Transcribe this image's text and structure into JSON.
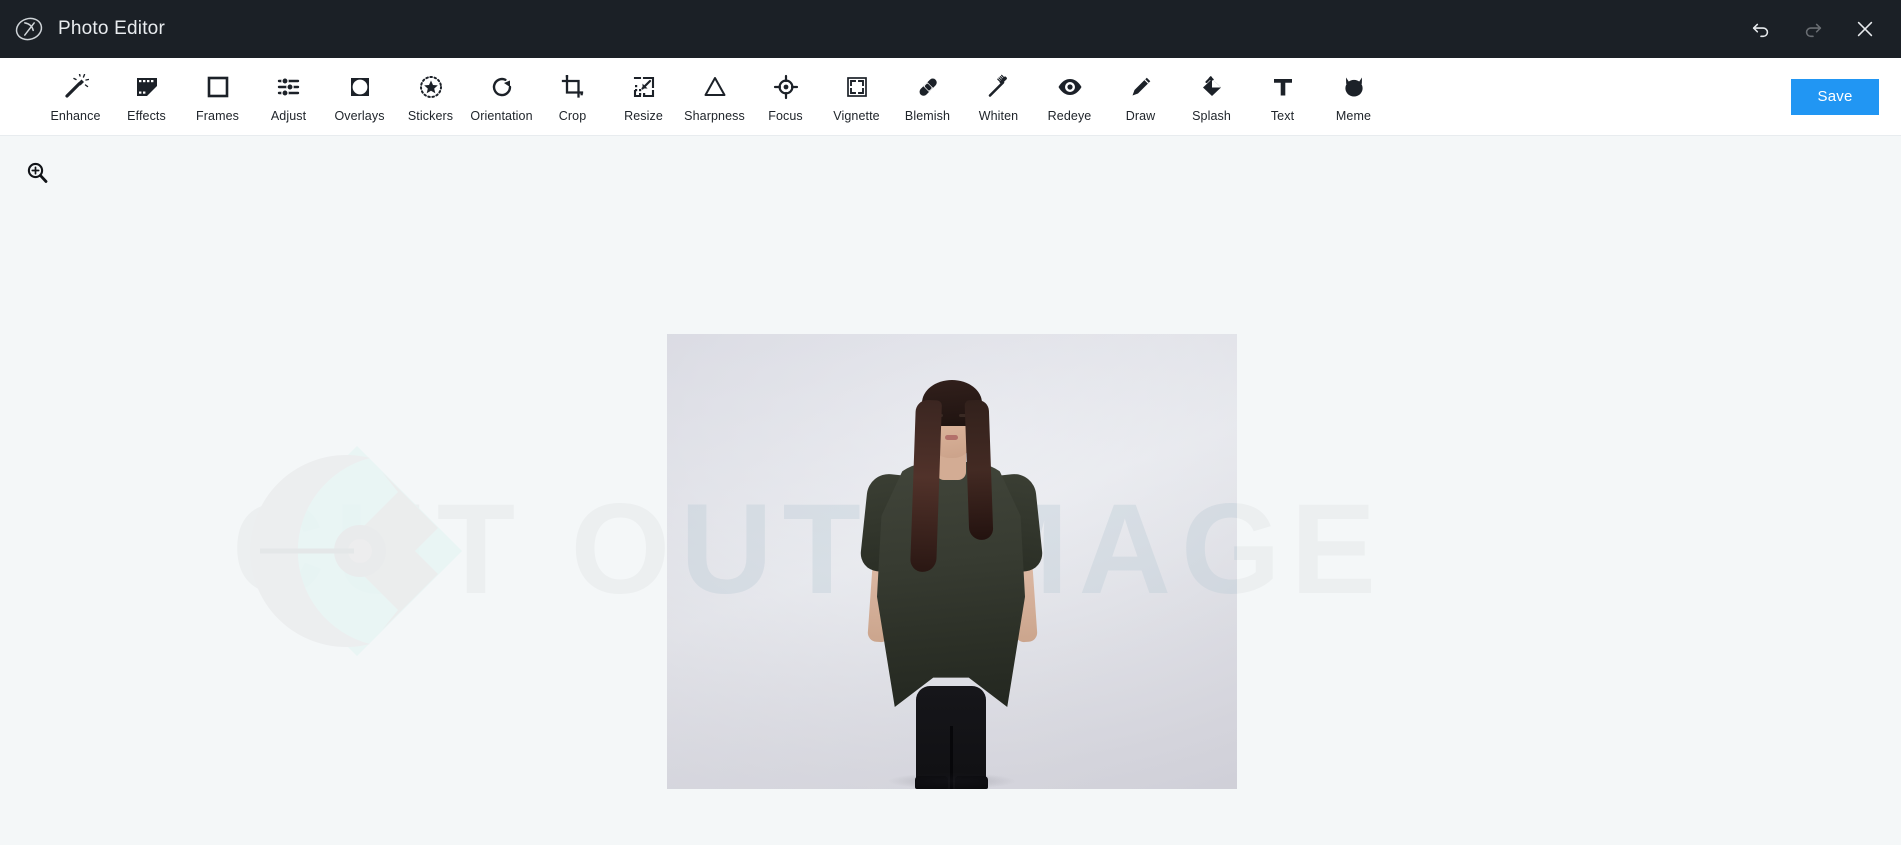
{
  "window": {
    "title": "Photo Editor",
    "logo_icon": "creative-cloud-logo",
    "undo_icon": "undo-arrow-icon",
    "undo_label": "Undo",
    "redo_icon": "redo-arrow-icon",
    "redo_label": "Redo",
    "redo_disabled": true,
    "close_icon": "close-x-icon",
    "close_label": "Close",
    "background_color": "#1b2026",
    "title_color": "#e9ecef"
  },
  "toolbar": {
    "background_color": "#ffffff",
    "tools": [
      {
        "label": "Enhance",
        "icon": "magic-wand-icon"
      },
      {
        "label": "Effects",
        "icon": "film-strip-icon"
      },
      {
        "label": "Frames",
        "icon": "square-frame-icon"
      },
      {
        "label": "Adjust",
        "icon": "sliders-icon"
      },
      {
        "label": "Overlays",
        "icon": "circle-in-square-icon"
      },
      {
        "label": "Stickers",
        "icon": "dotted-star-icon"
      },
      {
        "label": "Orientation",
        "icon": "rotate-clockwise-icon"
      },
      {
        "label": "Crop",
        "icon": "crop-icon"
      },
      {
        "label": "Resize",
        "icon": "resize-arrow-icon"
      },
      {
        "label": "Sharpness",
        "icon": "triangle-icon"
      },
      {
        "label": "Focus",
        "icon": "crosshair-target-icon"
      },
      {
        "label": "Vignette",
        "icon": "corner-brackets-square-icon"
      },
      {
        "label": "Blemish",
        "icon": "bandage-icon"
      },
      {
        "label": "Whiten",
        "icon": "toothbrush-icon"
      },
      {
        "label": "Redeye",
        "icon": "eye-icon"
      },
      {
        "label": "Draw",
        "icon": "pencil-icon"
      },
      {
        "label": "Splash",
        "icon": "paint-bucket-icon"
      },
      {
        "label": "Text",
        "icon": "text-t-icon"
      },
      {
        "label": "Meme",
        "icon": "cat-face-icon"
      }
    ],
    "save_label": "Save",
    "save_color": "#2196f3"
  },
  "canvas": {
    "background_color": "#f4f7f8",
    "zoom_icon": "zoom-in-magnifier-icon",
    "zoom_label": "Zoom",
    "watermark_text": "CUT OUT IMAGE",
    "watermark_mark_icon": "cutout-image-logo-mark",
    "photo_alt": "Woman in dark olive tunic top standing against a light studio backdrop"
  }
}
